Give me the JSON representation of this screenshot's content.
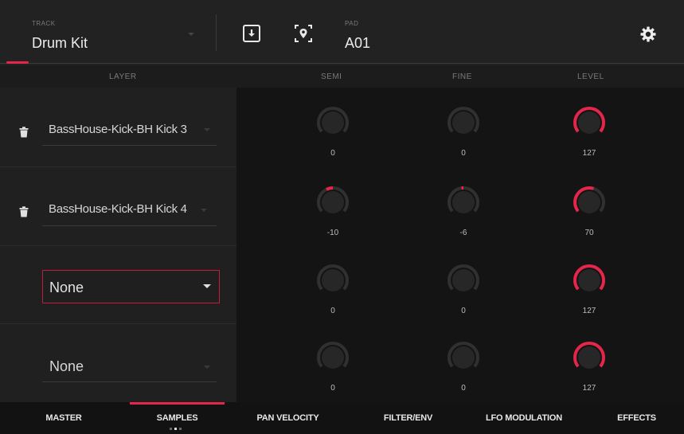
{
  "header": {
    "track_label": "TRACK",
    "track_value": "Drum Kit",
    "pad_label": "PAD",
    "pad_value": "A01",
    "icons": [
      "download-icon",
      "locate-icon",
      "gear-icon"
    ]
  },
  "columns": {
    "layer": "LAYER",
    "semi": "SEMI",
    "fine": "FINE",
    "level": "LEVEL"
  },
  "layers": [
    {
      "name": "BassHouse-Kick-BH Kick 3",
      "semi": "0",
      "fine": "0",
      "level": "127"
    },
    {
      "name": "BassHouse-Kick-BH Kick 4",
      "semi": "-10",
      "fine": "-6",
      "level": "70"
    },
    {
      "name": "None",
      "semi": "0",
      "fine": "0",
      "level": "127"
    },
    {
      "name": "None",
      "semi": "0",
      "fine": "0",
      "level": "127"
    }
  ],
  "tabs": [
    {
      "label": "MASTER",
      "active": false
    },
    {
      "label": "SAMPLES",
      "active": true
    },
    {
      "label": "PAN VELOCITY",
      "active": false
    },
    {
      "label": "FILTER/ENV",
      "active": false
    },
    {
      "label": "LFO MODULATION",
      "active": false
    },
    {
      "label": "EFFECTS",
      "active": false
    }
  ],
  "colors": {
    "accent": "#e3264a",
    "background": "#1a1a1a"
  }
}
